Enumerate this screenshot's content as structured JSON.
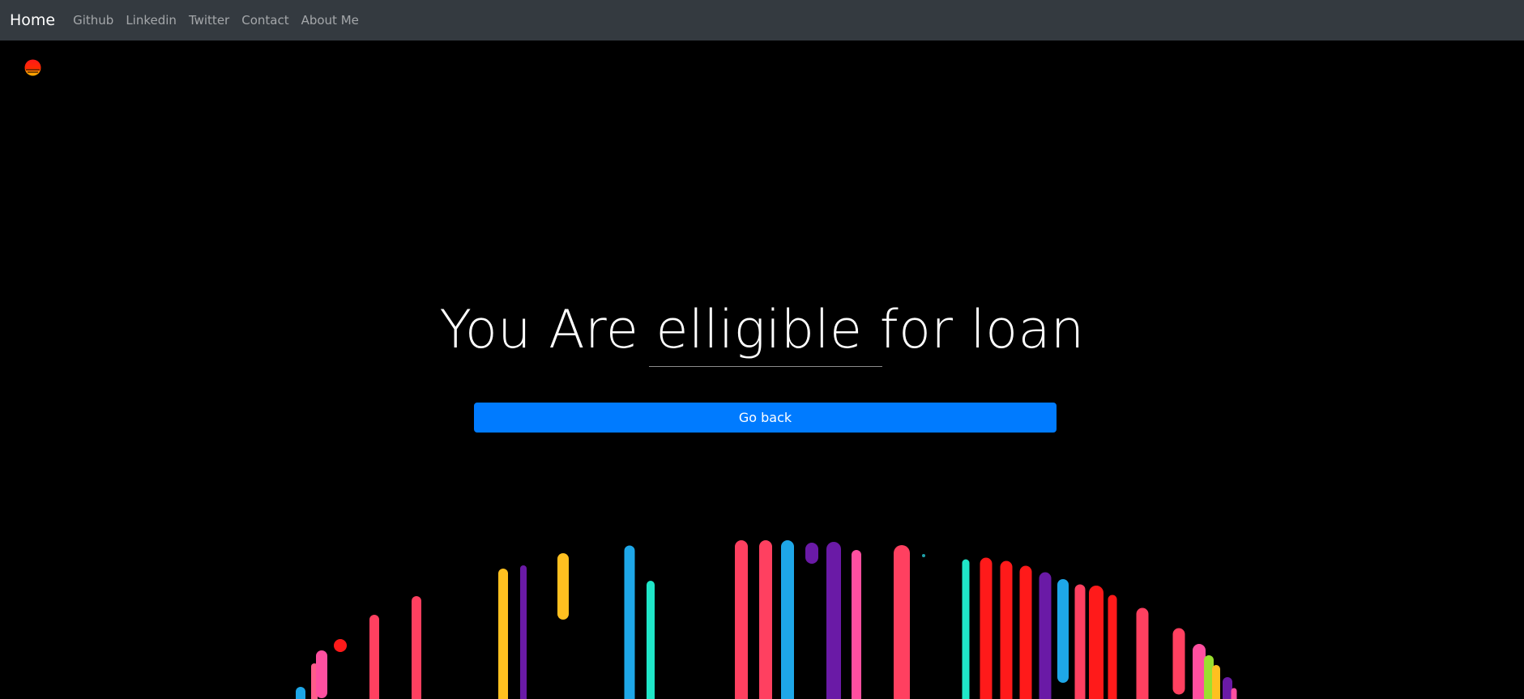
{
  "nav": {
    "brand": "Home",
    "links": [
      "Github",
      "Linkedin",
      "Twitter",
      "Contact",
      "About Me"
    ]
  },
  "hero": {
    "headline": "You Are elligible for loan",
    "button_label": "Go back"
  },
  "icons": {
    "logo": "red-orange-sun-logo-icon"
  },
  "colors": {
    "navbar_bg": "#343a40",
    "page_bg": "#000000",
    "button_bg": "#007bff",
    "text_primary": "#ffffff"
  }
}
